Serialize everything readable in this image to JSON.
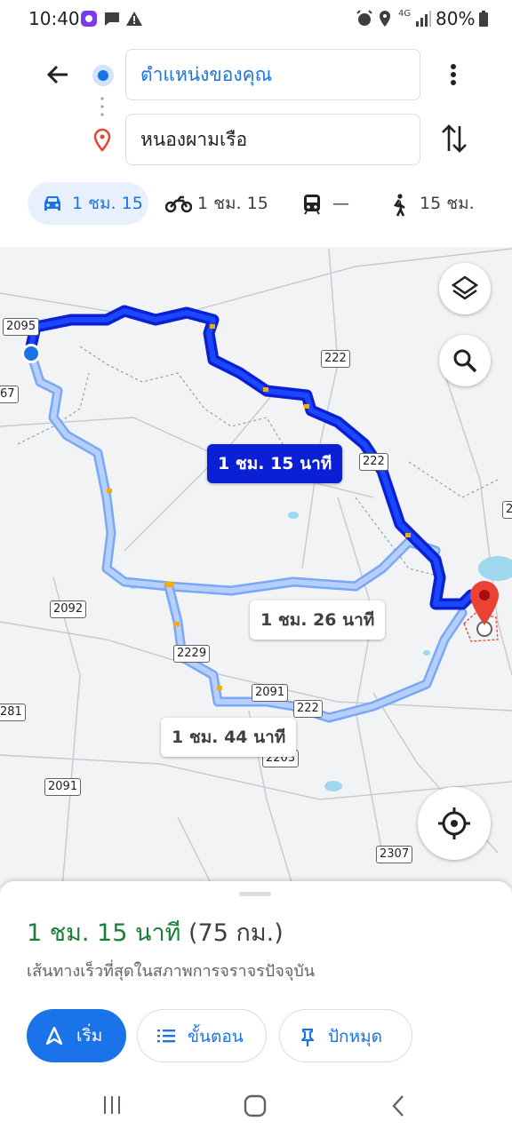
{
  "status": {
    "time": "10:40",
    "network": "4G",
    "battery": "80%"
  },
  "search": {
    "origin": "ตำแหน่งของคุณ",
    "destination": "หนองผามเรือ"
  },
  "modes": [
    {
      "icon": "car-icon",
      "label": "1 ชม. 15"
    },
    {
      "icon": "motorcycle-icon",
      "label": "1 ชม. 15"
    },
    {
      "icon": "transit-icon",
      "label": "—"
    },
    {
      "icon": "walk-icon",
      "label": "15 ชม."
    }
  ],
  "map": {
    "road_labels": [
      "2095",
      "67",
      "222",
      "222",
      "2",
      "2092",
      "2229",
      "2091",
      "222",
      "281",
      "2091",
      "2307",
      "2203"
    ],
    "routes": [
      {
        "label": "1 ชม. 15 นาที",
        "selected": true
      },
      {
        "label": "1 ชม. 26 นาที",
        "selected": false
      },
      {
        "label": "1 ชม. 44 นาที",
        "selected": false
      }
    ]
  },
  "summary": {
    "time": "1 ชม. 15 นาที",
    "distance": "(75 กม.)",
    "note": "เส้นทางเร็วที่สุดในสภาพการจราจรปัจจุบัน"
  },
  "actions": {
    "start": "เริ่ม",
    "steps": "ขั้นตอน",
    "pin": "ปักหมุด"
  },
  "colors": {
    "accent": "#1a73e8",
    "route_selected": "#0b1fd4",
    "route_alt": "#a8c7fa",
    "eta_green": "#188038",
    "pin_red": "#ea4335"
  }
}
